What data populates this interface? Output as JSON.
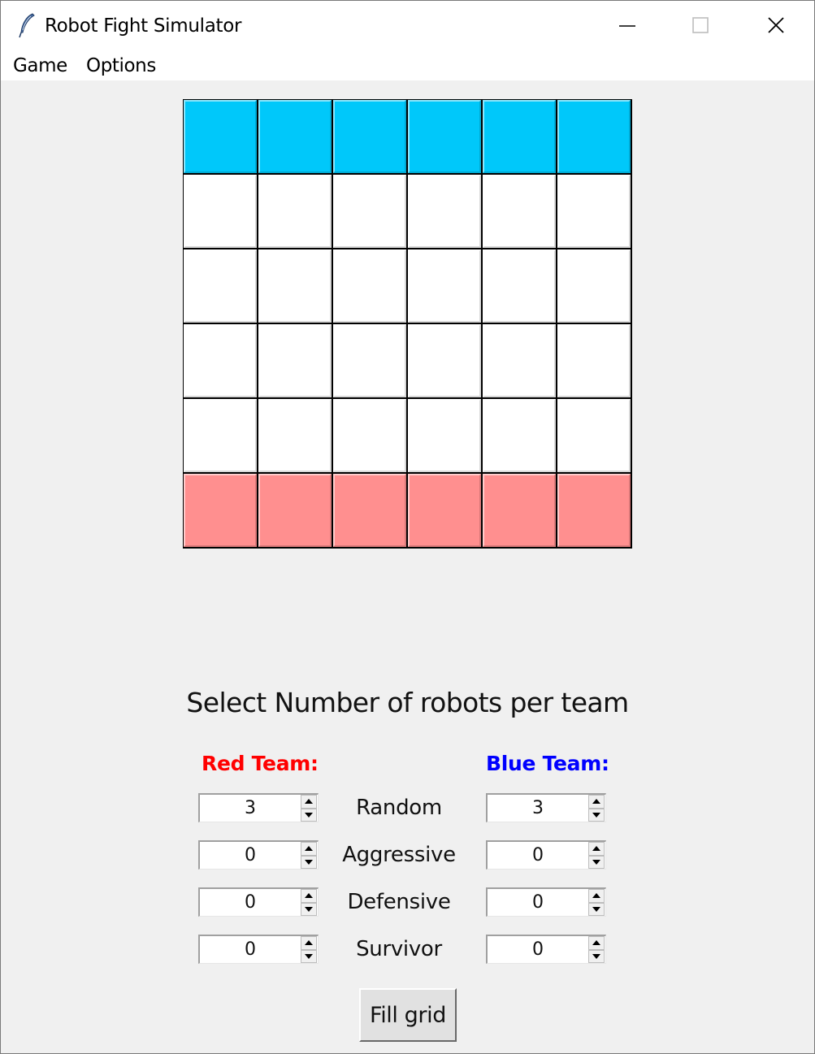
{
  "window": {
    "title": "Robot Fight Simulator"
  },
  "menu": {
    "game": "Game",
    "options": "Options"
  },
  "grid": {
    "rows": [
      [
        "blue",
        "blue",
        "blue",
        "blue",
        "blue",
        "blue"
      ],
      [
        "empty",
        "empty",
        "empty",
        "empty",
        "empty",
        "empty"
      ],
      [
        "empty",
        "empty",
        "empty",
        "empty",
        "empty",
        "empty"
      ],
      [
        "empty",
        "empty",
        "empty",
        "empty",
        "empty",
        "empty"
      ],
      [
        "empty",
        "empty",
        "empty",
        "empty",
        "empty",
        "empty"
      ],
      [
        "red",
        "red",
        "red",
        "red",
        "red",
        "red"
      ]
    ],
    "colors": {
      "blue": "#00c8fa",
      "empty": "#ffffff",
      "red": "#ff8f8f"
    }
  },
  "setup": {
    "heading": "Select Number of robots per team",
    "red_label": "Red Team:",
    "blue_label": "Blue Team:",
    "red_color": "#ff0000",
    "blue_color": "#0000ff",
    "robot_types": [
      {
        "label": "Random",
        "red": "3",
        "blue": "3"
      },
      {
        "label": "Aggressive",
        "red": "0",
        "blue": "0"
      },
      {
        "label": "Defensive",
        "red": "0",
        "blue": "0"
      },
      {
        "label": "Survivor",
        "red": "0",
        "blue": "0"
      }
    ],
    "fill_button": "Fill grid"
  },
  "icons": {
    "app": "feather-icon",
    "minimize": "minimize-icon",
    "maximize": "maximize-icon",
    "close": "close-icon",
    "spin_up": "arrow-up-icon",
    "spin_down": "arrow-down-icon"
  }
}
